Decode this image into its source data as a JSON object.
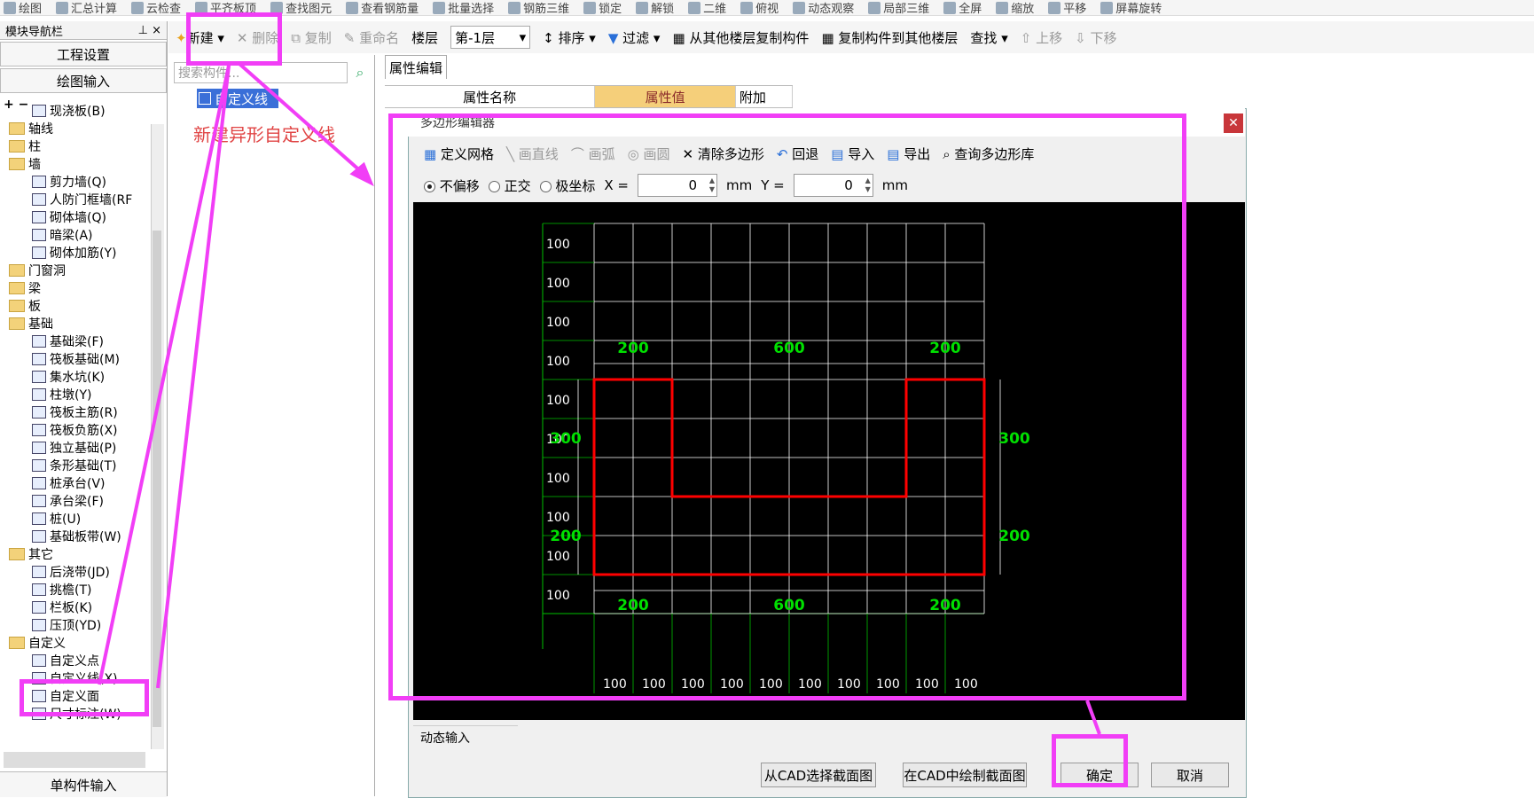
{
  "top_toolbar": {
    "items": [
      "绘图",
      "汇总计算",
      "云检查",
      "平齐板顶",
      "查找图元",
      "查看钢筋量",
      "批量选择",
      "钢筋三维",
      "锁定",
      "解锁",
      "二维",
      "俯视",
      "动态观察",
      "局部三维",
      "全屏",
      "缩放",
      "平移",
      "屏幕旋转"
    ]
  },
  "nav": {
    "title": "模块导航栏",
    "btn_project": "工程设置",
    "btn_draw": "绘图输入",
    "footer": "单构件输入",
    "tree": [
      {
        "label": "现浇板(B)",
        "level": 2
      },
      {
        "label": "轴线",
        "level": 1
      },
      {
        "label": "柱",
        "level": 1
      },
      {
        "label": "墙",
        "level": 1
      },
      {
        "label": "剪力墙(Q)",
        "level": 2
      },
      {
        "label": "人防门框墙(RF",
        "level": 2
      },
      {
        "label": "砌体墙(Q)",
        "level": 2
      },
      {
        "label": "暗梁(A)",
        "level": 2
      },
      {
        "label": "砌体加筋(Y)",
        "level": 2
      },
      {
        "label": "门窗洞",
        "level": 1
      },
      {
        "label": "梁",
        "level": 1
      },
      {
        "label": "板",
        "level": 1
      },
      {
        "label": "基础",
        "level": 1
      },
      {
        "label": "基础梁(F)",
        "level": 2
      },
      {
        "label": "筏板基础(M)",
        "level": 2
      },
      {
        "label": "集水坑(K)",
        "level": 2
      },
      {
        "label": "柱墩(Y)",
        "level": 2
      },
      {
        "label": "筏板主筋(R)",
        "level": 2
      },
      {
        "label": "筏板负筋(X)",
        "level": 2
      },
      {
        "label": "独立基础(P)",
        "level": 2
      },
      {
        "label": "条形基础(T)",
        "level": 2
      },
      {
        "label": "桩承台(V)",
        "level": 2
      },
      {
        "label": "承台梁(F)",
        "level": 2
      },
      {
        "label": "桩(U)",
        "level": 2
      },
      {
        "label": "基础板带(W)",
        "level": 2
      },
      {
        "label": "其它",
        "level": 1
      },
      {
        "label": "后浇带(JD)",
        "level": 2
      },
      {
        "label": "挑檐(T)",
        "level": 2
      },
      {
        "label": "栏板(K)",
        "level": 2
      },
      {
        "label": "压顶(YD)",
        "level": 2
      },
      {
        "label": "自定义",
        "level": 1
      },
      {
        "label": "自定义点",
        "level": 2
      },
      {
        "label": "自定义线(X)",
        "level": 2
      },
      {
        "label": "自定义面",
        "level": 2
      },
      {
        "label": "尺寸标注(W)",
        "level": 2
      }
    ]
  },
  "toolbar2": {
    "new": "新建",
    "delete": "删除",
    "copy": "复制",
    "rename": "重命名",
    "floor_label": "楼层",
    "floor_value": "第-1层",
    "sort": "排序",
    "filter": "过滤",
    "copy_from": "从其他楼层复制构件",
    "copy_to": "复制构件到其他楼层",
    "find": "查找",
    "up": "上移",
    "down": "下移"
  },
  "component": {
    "search_placeholder": "搜索构件...",
    "selected_item": "自定义线",
    "annotation": "新建异形自定义线"
  },
  "property": {
    "tab": "属性编辑",
    "col_name": "属性名称",
    "col_value": "属性值",
    "col_extra": "附加"
  },
  "dialog": {
    "title": "多边形编辑器",
    "toolbar": {
      "define_grid": "定义网格",
      "draw_line": "画直线",
      "draw_arc": "画弧",
      "draw_circle": "画圆",
      "clear": "清除多边形",
      "undo": "回退",
      "import": "导入",
      "export": "导出",
      "query": "查询多边形库"
    },
    "offset": {
      "opt1": "不偏移",
      "opt2": "正交",
      "opt3": "极坐标",
      "x_label": "X =",
      "x_value": "0",
      "y_label": "Y =",
      "y_value": "0",
      "unit": "mm"
    },
    "dynamic_input": "动态输入",
    "btn_cad_select": "从CAD选择截面图",
    "btn_cad_draw": "在CAD中绘制截面图",
    "btn_ok": "确定",
    "btn_cancel": "取消"
  },
  "grid": {
    "row_labels": [
      "100",
      "100",
      "100",
      "100",
      "100",
      "100",
      "100",
      "100",
      "100",
      "100"
    ],
    "col_labels": [
      "100",
      "100",
      "100",
      "100",
      "100",
      "100",
      "100",
      "100",
      "100",
      "100"
    ],
    "top_dims": [
      "200",
      "600",
      "200"
    ],
    "bottom_dims": [
      "200",
      "600",
      "200"
    ],
    "left_dims": [
      "300",
      "200"
    ],
    "right_dims": [
      "300",
      "200"
    ],
    "colors": {
      "grid": "#ffffff",
      "label": "#ffffff",
      "dim": "#00e000",
      "shape": "#ff0000",
      "axis": "#00c000"
    }
  }
}
